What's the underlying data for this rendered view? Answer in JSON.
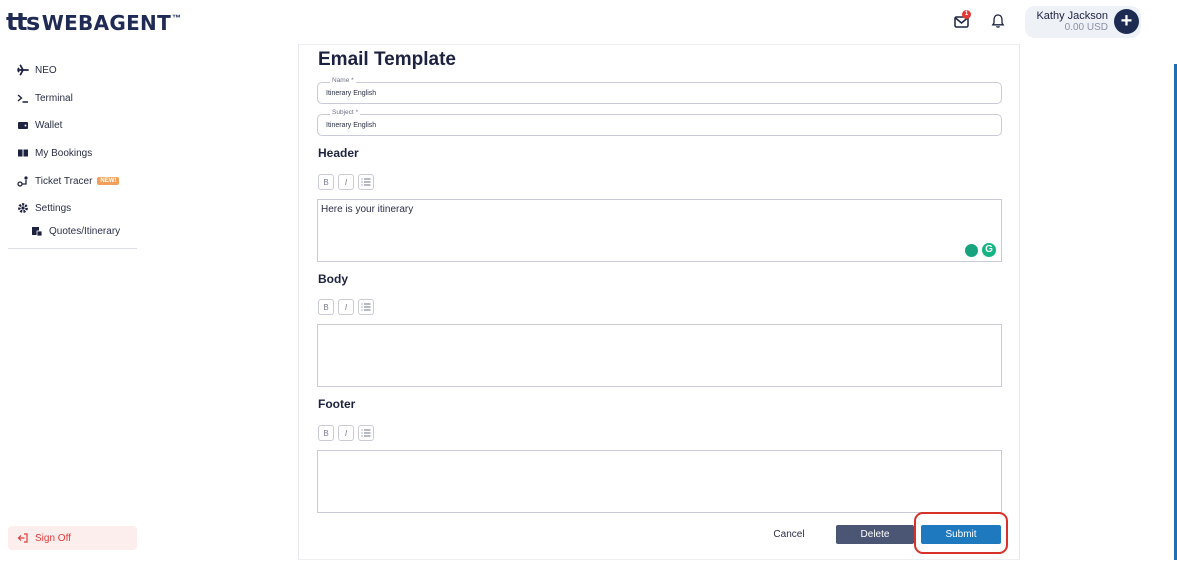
{
  "app": {
    "logo_prefix": "tts",
    "logo_name": "WEBAGENT",
    "logo_tm": "™"
  },
  "header": {
    "mail_badge": "1",
    "mail_icon": "envelope-icon",
    "bell_icon": "bell-icon",
    "user_name": "Kathy Jackson",
    "user_balance": "0.00 USD",
    "add_icon": "plus-icon"
  },
  "sidebar": {
    "items": [
      {
        "label": "NEO",
        "icon": "airplane-icon"
      },
      {
        "label": "Terminal",
        "icon": "terminal-icon"
      },
      {
        "label": "Wallet",
        "icon": "wallet-icon"
      },
      {
        "label": "My Bookings",
        "icon": "book-icon"
      },
      {
        "label": "Ticket Tracer",
        "icon": "tracer-icon",
        "badge": "NEW!"
      },
      {
        "label": "Settings",
        "icon": "gear-icon"
      },
      {
        "label": "Quotes/Itinerary",
        "icon": "quotes-icon"
      }
    ],
    "sign_off": "Sign Off"
  },
  "form": {
    "title": "Email Template",
    "name_legend": "Name *",
    "name_value": "Itinerary English",
    "subject_legend": "Subject *",
    "subject_value": "Itinerary English",
    "sections": [
      {
        "label": "Header",
        "content": "Here is your itinerary"
      },
      {
        "label": "Body",
        "content": ""
      },
      {
        "label": "Footer",
        "content": ""
      }
    ],
    "toolbar": {
      "bold": "B",
      "italic": "I"
    },
    "buttons": {
      "cancel": "Cancel",
      "delete": "Delete",
      "submit": "Submit"
    }
  },
  "colors": {
    "brand_navy": "#1f2a55",
    "submit_blue": "#1f79be",
    "delete_slate": "#4b5574",
    "signoff_red": "#e03c3c",
    "highlight_red": "#d8312c",
    "new_badge": "#f2a05b"
  }
}
